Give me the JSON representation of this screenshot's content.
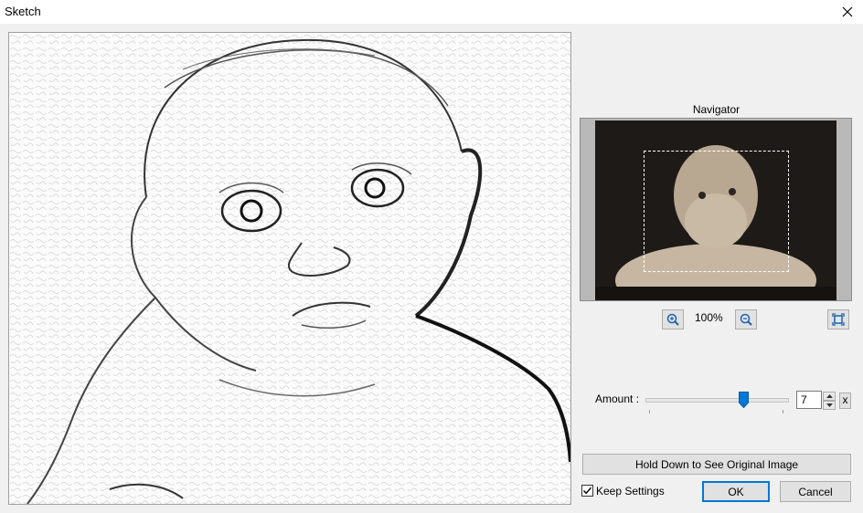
{
  "window": {
    "title": "Sketch",
    "close_icon": "close-icon"
  },
  "navigator": {
    "label": "Navigator",
    "zoom_in_icon": "zoom-in-icon",
    "zoom_out_icon": "zoom-out-icon",
    "fit_icon": "fit-to-window-icon",
    "zoom_level": "100%"
  },
  "amount": {
    "label": "Amount :",
    "value": "7",
    "slider_fraction": 0.7,
    "reset_label": "x"
  },
  "buttons": {
    "hold_original": "Hold Down to See Original Image",
    "ok": "OK",
    "cancel": "Cancel"
  },
  "keep_settings": {
    "label": "Keep Settings",
    "checked": true
  },
  "colors": {
    "accent": "#0078d7",
    "slider_thumb": "#0078d7"
  }
}
